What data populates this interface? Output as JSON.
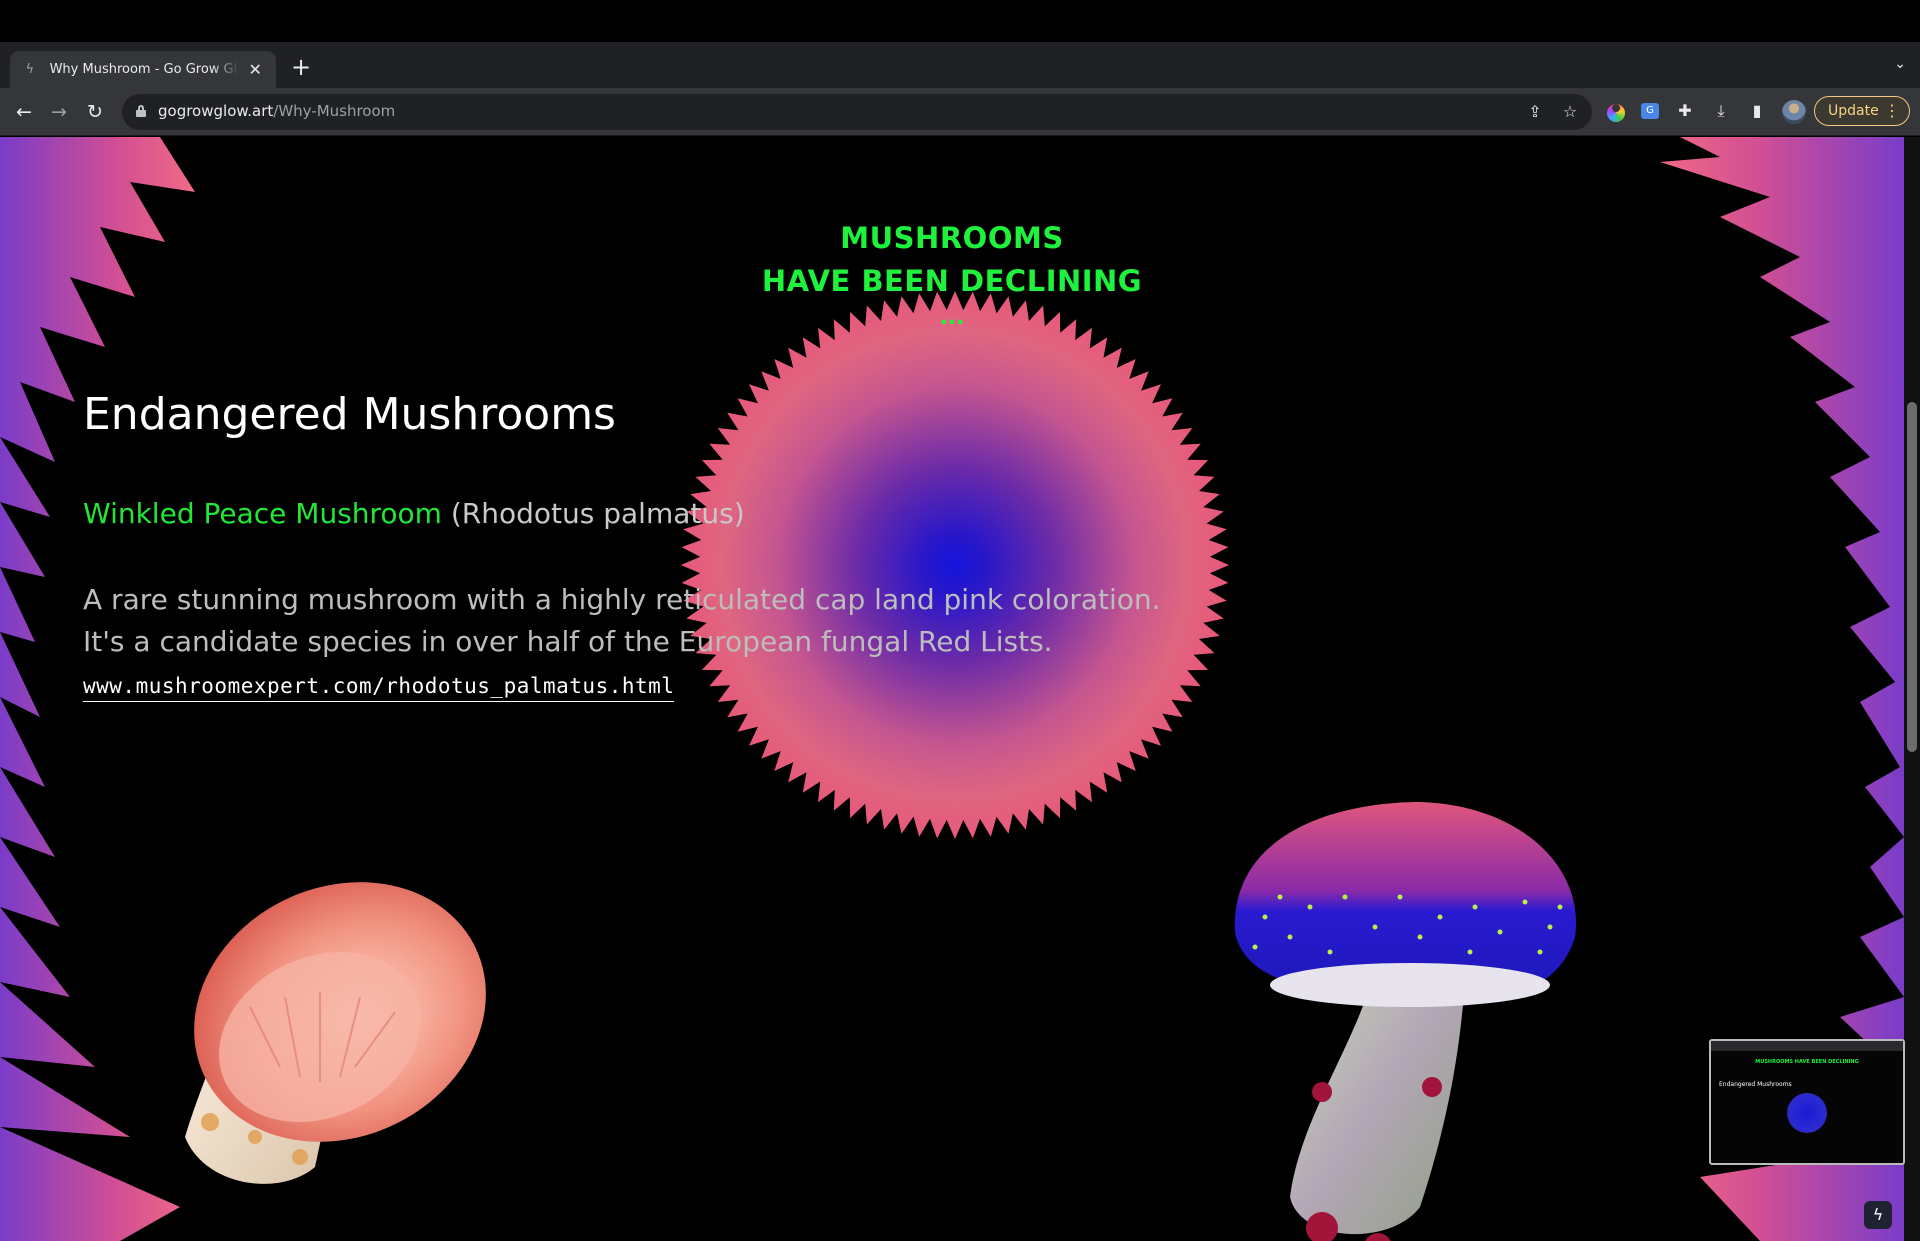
{
  "browser": {
    "tab_title": "Why Mushroom - Go Grow Glow",
    "tab_favicon": "bolt-icon",
    "new_tab": "+",
    "url_domain": "gogrowglow.art",
    "url_path": "/Why-Mushroom",
    "update_label": "Update",
    "colors": {
      "tabstrip": "#202124",
      "toolbar": "#35363a",
      "update_accent": "#fbd383"
    }
  },
  "page": {
    "headline_line1": "MUSHROOMS",
    "headline_line2": "HAVE BEEN DECLINING",
    "headline_ellipsis": "...",
    "section_title": "Endangered Mushrooms",
    "species_common": "Winkled Peace Mushroom",
    "species_latin": "(Rhodotus palmatus)",
    "description_line1": "A rare stunning mushroom with a highly reticulated cap land pink coloration.",
    "description_line2": "It's a candidate species in over half of the European fungal Red Lists.",
    "source_link": "www.mushroomexpert.com/rhodotus_palmatus.html",
    "colors": {
      "accent_green": "#1ef23c",
      "blob_pink": "#e4607a",
      "blob_core": "#1a1ad8",
      "spikes": "#d9508a"
    }
  },
  "preview": {
    "title": "MUSHROOMS HAVE BEEN DECLINING",
    "heading": "Endangered Mushrooms"
  }
}
